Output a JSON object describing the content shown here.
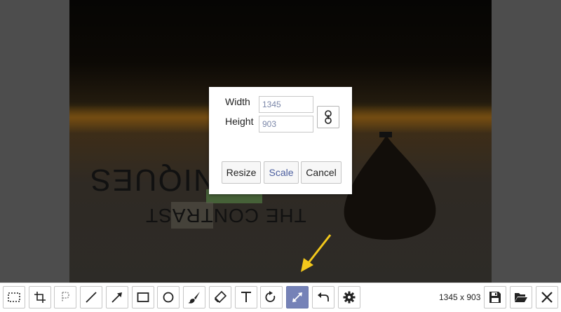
{
  "canvas": {
    "bg_text_line1": "SEQUINIQUES",
    "bg_text_line2": "THE CONTRAST"
  },
  "resize_dialog": {
    "width_label": "Width",
    "height_label": "Height",
    "width_value": "1345",
    "height_value": "903",
    "link_icon": "link-icon",
    "buttons": {
      "resize": "Resize",
      "scale": "Scale",
      "cancel": "Cancel"
    }
  },
  "toolbar": {
    "tools": [
      {
        "name": "select-tool",
        "icon": "dashed-rectangle-icon"
      },
      {
        "name": "crop-tool",
        "icon": "crop-icon"
      },
      {
        "name": "pixelate-tool",
        "icon": "pixelate-p-icon"
      },
      {
        "name": "line-tool",
        "icon": "line-icon"
      },
      {
        "name": "arrow-tool",
        "icon": "arrow-icon"
      },
      {
        "name": "rectangle-tool",
        "icon": "rectangle-icon"
      },
      {
        "name": "ellipse-tool",
        "icon": "circle-icon"
      },
      {
        "name": "brush-tool",
        "icon": "paintbrush-icon"
      },
      {
        "name": "eraser-tool",
        "icon": "eraser-icon"
      },
      {
        "name": "text-tool",
        "icon": "text-t-icon"
      },
      {
        "name": "rotate-tool",
        "icon": "rotate-icon"
      },
      {
        "name": "resize-tool",
        "icon": "resize-arrows-icon",
        "active": true
      },
      {
        "name": "undo-tool",
        "icon": "undo-icon"
      },
      {
        "name": "settings-tool",
        "icon": "gear-icon"
      }
    ],
    "size_readout": "1345 x 903",
    "right_buttons": [
      {
        "name": "save-button",
        "icon": "floppy-disk-icon"
      },
      {
        "name": "open-button",
        "icon": "folder-open-icon"
      },
      {
        "name": "close-button",
        "icon": "close-x-icon"
      }
    ]
  },
  "colors": {
    "active_tool": "#7582b7",
    "annotation_arrow": "#f3c81b"
  }
}
